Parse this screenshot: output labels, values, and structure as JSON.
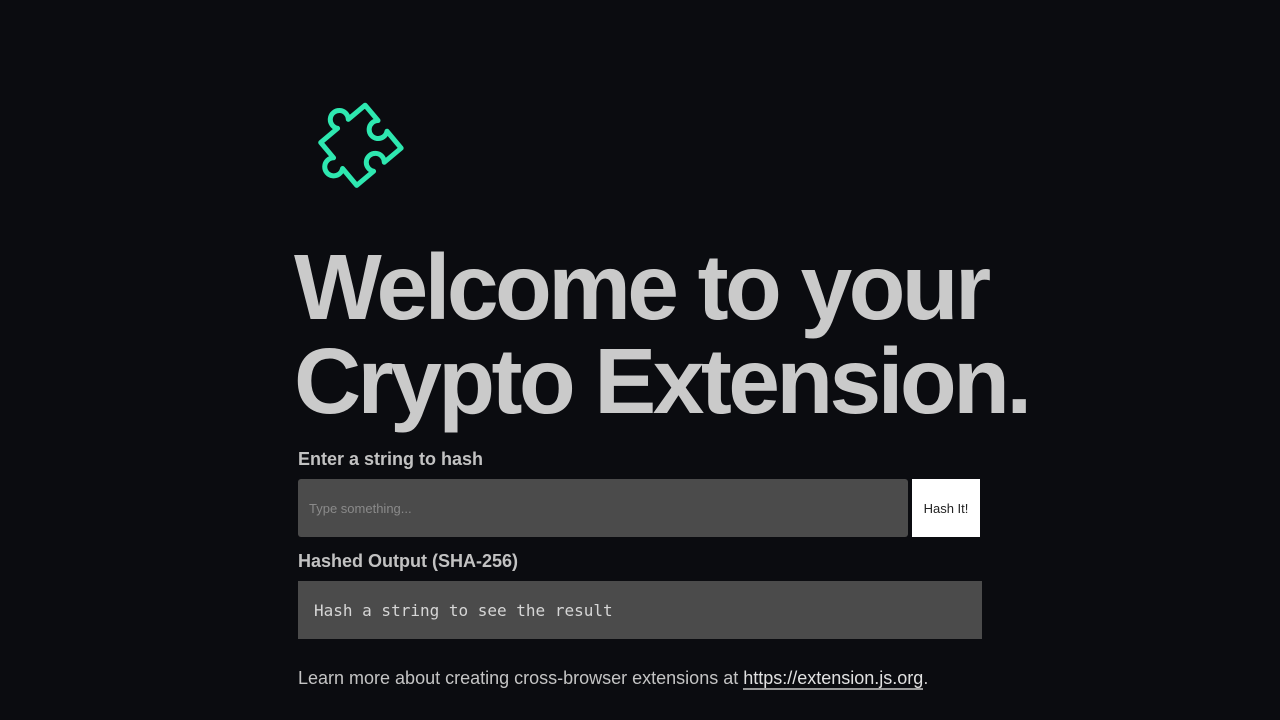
{
  "colors": {
    "background": "#0b0c10",
    "accent": "#2ee8b0",
    "headline": "#cacaca",
    "field_bg": "#4b4b4b",
    "button_bg": "#ffffff"
  },
  "logo": {
    "icon": "puzzle-piece-icon"
  },
  "headline": {
    "line1": "Welcome to your",
    "line2": "Crypto Extension."
  },
  "input_section": {
    "label": "Enter a string to hash",
    "placeholder": "Type something...",
    "value": "",
    "button_label": "Hash It!"
  },
  "output_section": {
    "label": "Hashed Output (SHA-256)",
    "result": "Hash a string to see the result"
  },
  "footer": {
    "text_before": "Learn more about creating cross-browser extensions at ",
    "link_text": "https://extension.js.org",
    "text_after": "."
  }
}
